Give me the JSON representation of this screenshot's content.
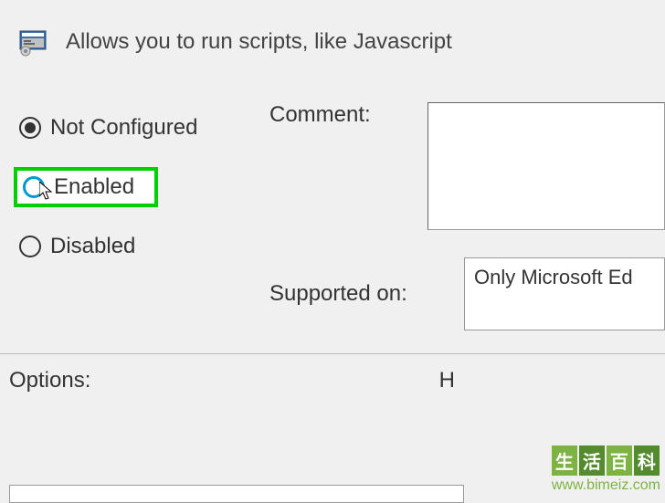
{
  "header": {
    "title": "Allows you to run scripts, like Javascript"
  },
  "radios": {
    "not_configured": "Not Configured",
    "enabled": "Enabled",
    "disabled": "Disabled"
  },
  "fields": {
    "comment_label": "Comment:",
    "comment_value": "",
    "supported_label": "Supported on:",
    "supported_value": "Only Microsoft Ed"
  },
  "bottom": {
    "options_label": "Options:",
    "help_label": "H"
  },
  "watermark": {
    "chars": [
      "生",
      "活",
      "百",
      "科"
    ],
    "url": "www.bimeiz.com"
  }
}
